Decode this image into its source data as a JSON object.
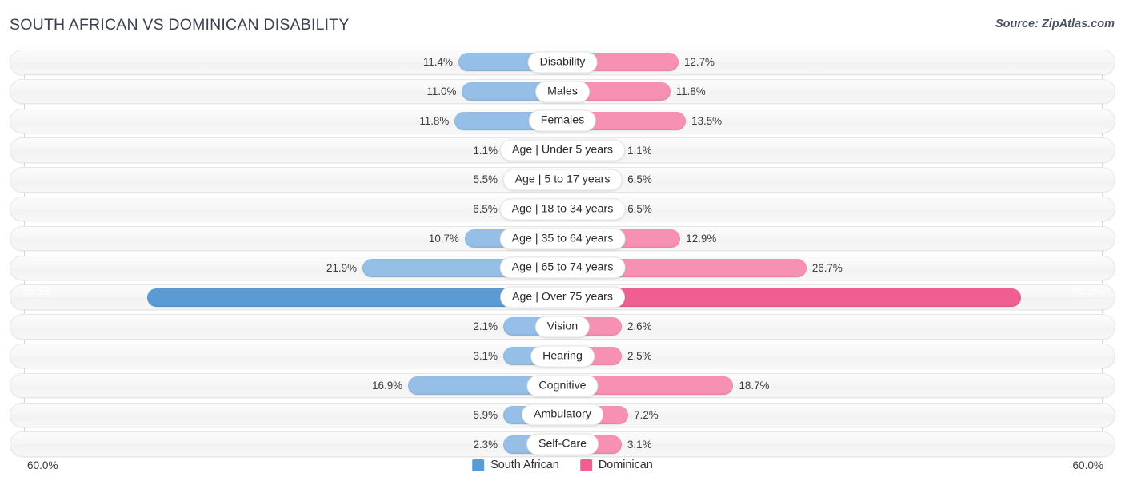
{
  "header": {
    "title": "SOUTH AFRICAN VS DOMINICAN DISABILITY",
    "source": "Source: ZipAtlas.com"
  },
  "axis": {
    "left_label": "60.0%",
    "right_label": "60.0%",
    "max": 60.0
  },
  "legend": {
    "items": [
      {
        "label": "South African",
        "color": "#5b9bd5"
      },
      {
        "label": "Dominican",
        "color": "#ef5f94"
      }
    ]
  },
  "colors": {
    "left_bar": "#96bfe8",
    "right_bar": "#f791b4",
    "left_bar_highlight": "#5b9bd5",
    "right_bar_highlight": "#ef5f94",
    "row_track": "#f6f6f6",
    "text": "#3b3b44"
  },
  "chart_data": {
    "type": "bar",
    "title": "SOUTH AFRICAN VS DOMINICAN DISABILITY",
    "subtitle": "Source: ZipAtlas.com",
    "orientation": "horizontal-diverging",
    "xlabel": "",
    "ylabel": "",
    "xlim": [
      60.0,
      60.0
    ],
    "grid": true,
    "legend_position": "bottom-center",
    "categories": [
      "Disability",
      "Males",
      "Females",
      "Age | Under 5 years",
      "Age | 5 to 17 years",
      "Age | 18 to 34 years",
      "Age | 35 to 64 years",
      "Age | 65 to 74 years",
      "Age | Over 75 years",
      "Vision",
      "Hearing",
      "Cognitive",
      "Ambulatory",
      "Self-Care"
    ],
    "series": [
      {
        "name": "South African",
        "color": "#5b9bd5",
        "values": [
          11.4,
          11.0,
          11.8,
          1.1,
          5.5,
          6.5,
          10.7,
          21.9,
          45.5,
          2.1,
          3.1,
          16.9,
          5.9,
          2.3
        ]
      },
      {
        "name": "Dominican",
        "color": "#ef5f94",
        "values": [
          12.7,
          11.8,
          13.5,
          1.1,
          6.5,
          6.5,
          12.9,
          26.7,
          50.2,
          2.6,
          2.5,
          18.7,
          7.2,
          3.1
        ]
      }
    ]
  },
  "rows": [
    {
      "category": "Disability",
      "left": "11.4%",
      "right": "12.7%",
      "left_val": 11.4,
      "right_val": 12.7,
      "highlight": false
    },
    {
      "category": "Males",
      "left": "11.0%",
      "right": "11.8%",
      "left_val": 11.0,
      "right_val": 11.8,
      "highlight": false
    },
    {
      "category": "Females",
      "left": "11.8%",
      "right": "13.5%",
      "left_val": 11.8,
      "right_val": 13.5,
      "highlight": false
    },
    {
      "category": "Age | Under 5 years",
      "left": "1.1%",
      "right": "1.1%",
      "left_val": 1.1,
      "right_val": 1.1,
      "highlight": false
    },
    {
      "category": "Age | 5 to 17 years",
      "left": "5.5%",
      "right": "6.5%",
      "left_val": 5.5,
      "right_val": 6.5,
      "highlight": false
    },
    {
      "category": "Age | 18 to 34 years",
      "left": "6.5%",
      "right": "6.5%",
      "left_val": 6.5,
      "right_val": 6.5,
      "highlight": false
    },
    {
      "category": "Age | 35 to 64 years",
      "left": "10.7%",
      "right": "12.9%",
      "left_val": 10.7,
      "right_val": 12.9,
      "highlight": false
    },
    {
      "category": "Age | 65 to 74 years",
      "left": "21.9%",
      "right": "26.7%",
      "left_val": 21.9,
      "right_val": 26.7,
      "highlight": false
    },
    {
      "category": "Age | Over 75 years",
      "left": "45.5%",
      "right": "50.2%",
      "left_val": 45.5,
      "right_val": 50.2,
      "highlight": true
    },
    {
      "category": "Vision",
      "left": "2.1%",
      "right": "2.6%",
      "left_val": 2.1,
      "right_val": 2.6,
      "highlight": false
    },
    {
      "category": "Hearing",
      "left": "3.1%",
      "right": "2.5%",
      "left_val": 3.1,
      "right_val": 2.5,
      "highlight": false
    },
    {
      "category": "Cognitive",
      "left": "16.9%",
      "right": "18.7%",
      "left_val": 16.9,
      "right_val": 18.7,
      "highlight": false
    },
    {
      "category": "Ambulatory",
      "left": "5.9%",
      "right": "7.2%",
      "left_val": 5.9,
      "right_val": 7.2,
      "highlight": false
    },
    {
      "category": "Self-Care",
      "left": "2.3%",
      "right": "3.1%",
      "left_val": 2.3,
      "right_val": 3.1,
      "highlight": false
    }
  ]
}
